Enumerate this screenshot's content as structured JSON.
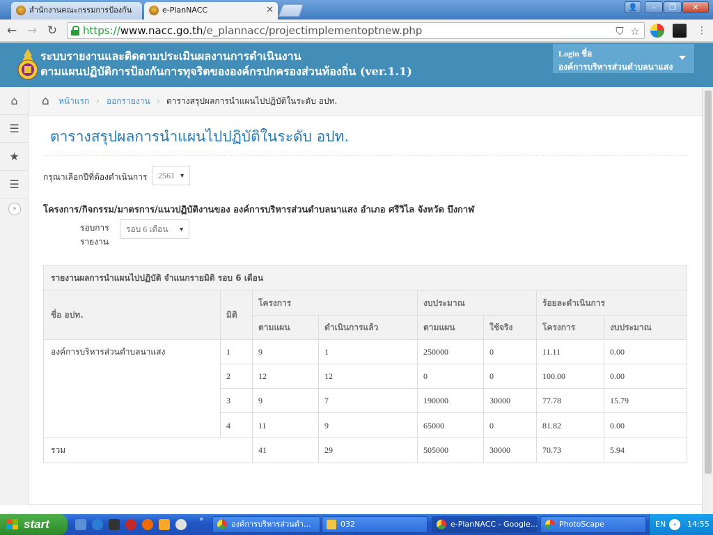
{
  "browser": {
    "tabs": [
      {
        "title": "สำนักงานคณะกรรมการป้องกัน"
      },
      {
        "title": "e-PlanNACC"
      }
    ],
    "url": {
      "scheme": "https://",
      "host": "www.nacc.go.th",
      "path": "/e_plannacc/projectimplementoptnew.php"
    }
  },
  "header": {
    "title_line1": "ระบบรายงานและติดตามประเมินผลงานการดำเนินงาน",
    "title_line2": "ตามแผนปฏิบัติการป้องกันการทุจริตขององค์กรปกครองส่วนท้องถิ่น (ver.1.1)",
    "login_label": "Login ชื่อ",
    "login_org": "องค์การบริหารส่วนตำบลนาแสง"
  },
  "breadcrumbs": [
    {
      "label": "หน้าแรก"
    },
    {
      "label": "ออกรายงาน"
    },
    {
      "label": "ตารางสรุปผลการนำแผนไปปฏิบัติในระดับ อปท."
    }
  ],
  "page_title": "ตารางสรุปผลการนำแผนไปปฏิบัติในระดับ อปท.",
  "year_filter": {
    "label": "กรุณาเลือกปีที่ต้องดำเนินการ",
    "value": "2561"
  },
  "project_heading": "โครงการ/กิจกรรม/มาตรการ/แนวปฏิบัติงานของ องค์การบริหารส่วนตำบลนาแสง อำเภอ ศรีวิไล จังหวัด บึงกาฬ",
  "round_filter": {
    "label_line1": "รอบการ",
    "label_line2": "รายงาน",
    "value": "รอบ 6 เดือน"
  },
  "report": {
    "heading": "รายงานผลการนำแผนไปปฏิบัติ จำแนกรายมิติ รอบ 6 เดือน",
    "headers": {
      "org_name": "ชื่อ อปท.",
      "dimension": "มิติ",
      "projects": "โครงการ",
      "budget": "งบประมาณ",
      "percent": "ร้อยละดำเนินการ",
      "planned": "ตามแผน",
      "done": "ดำเนินการแล้ว",
      "budget_planned": "ตามแผน",
      "budget_used": "ใช้จริง",
      "pct_projects": "โครงการ",
      "pct_budget": "งบประมาณ"
    },
    "org": "องค์การบริหารส่วนตำบลนาแสง",
    "rows": [
      {
        "dim": "1",
        "planned": "9",
        "done": "1",
        "budget_planned": "250000",
        "budget_used": "0",
        "pct_projects": "11.11",
        "pct_budget": "0.00"
      },
      {
        "dim": "2",
        "planned": "12",
        "done": "12",
        "budget_planned": "0",
        "budget_used": "0",
        "pct_projects": "100.00",
        "pct_budget": "0.00"
      },
      {
        "dim": "3",
        "planned": "9",
        "done": "7",
        "budget_planned": "190000",
        "budget_used": "30000",
        "pct_projects": "77.78",
        "pct_budget": "15.79"
      },
      {
        "dim": "4",
        "planned": "11",
        "done": "9",
        "budget_planned": "65000",
        "budget_used": "0",
        "pct_projects": "81.82",
        "pct_budget": "0.00"
      }
    ],
    "total": {
      "label": "รวม",
      "planned": "41",
      "done": "29",
      "budget_planned": "505000",
      "budget_used": "30000",
      "pct_projects": "70.73",
      "pct_budget": "5.94"
    }
  },
  "taskbar": {
    "start": "start",
    "items": [
      {
        "label": "องค์การบริหารส่วนตำ..."
      },
      {
        "label": "032"
      },
      {
        "label": "e-PlanNACC - Google..."
      },
      {
        "label": "PhotoScape"
      }
    ],
    "lang": "EN",
    "clock": "14:55"
  }
}
